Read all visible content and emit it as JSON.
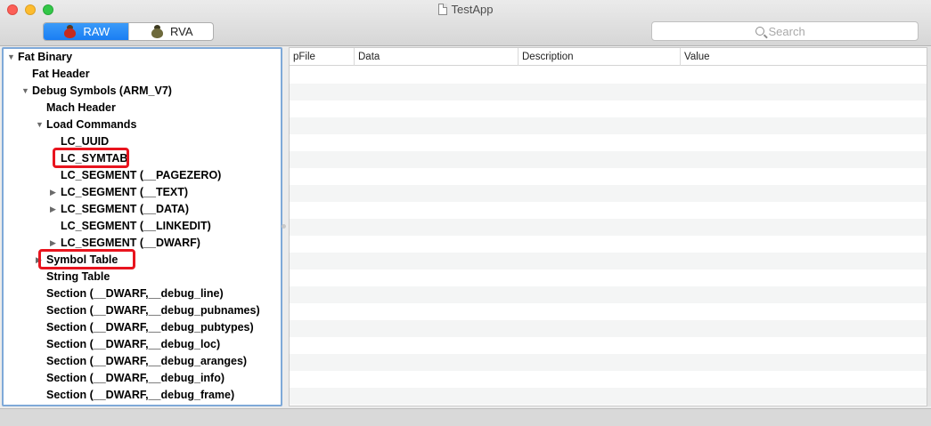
{
  "window": {
    "title": "TestApp"
  },
  "toolbar": {
    "segments": [
      {
        "label": "RAW",
        "active": true
      },
      {
        "label": "RVA",
        "active": false
      }
    ],
    "search": {
      "placeholder": "Search",
      "value": ""
    }
  },
  "outline": {
    "items": [
      {
        "label": "Fat Binary",
        "level": 0,
        "disclosure": "expanded"
      },
      {
        "label": "Fat Header",
        "level": 1,
        "disclosure": "none"
      },
      {
        "label": "Debug Symbols (ARM_V7)",
        "level": 1,
        "disclosure": "expanded"
      },
      {
        "label": "Mach Header",
        "level": 2,
        "disclosure": "none"
      },
      {
        "label": "Load Commands",
        "level": 2,
        "disclosure": "expanded"
      },
      {
        "label": "LC_UUID",
        "level": 3,
        "disclosure": "none"
      },
      {
        "label": "LC_SYMTAB",
        "level": 3,
        "disclosure": "none",
        "highlighted": true
      },
      {
        "label": "LC_SEGMENT (__PAGEZERO)",
        "level": 3,
        "disclosure": "none"
      },
      {
        "label": "LC_SEGMENT (__TEXT)",
        "level": 3,
        "disclosure": "collapsed"
      },
      {
        "label": "LC_SEGMENT (__DATA)",
        "level": 3,
        "disclosure": "collapsed"
      },
      {
        "label": "LC_SEGMENT (__LINKEDIT)",
        "level": 3,
        "disclosure": "none"
      },
      {
        "label": "LC_SEGMENT (__DWARF)",
        "level": 3,
        "disclosure": "collapsed"
      },
      {
        "label": "Symbol Table",
        "level": 2,
        "disclosure": "collapsed",
        "highlighted": true
      },
      {
        "label": "String Table",
        "level": 2,
        "disclosure": "none"
      },
      {
        "label": "Section (__DWARF,__debug_line)",
        "level": 2,
        "disclosure": "none"
      },
      {
        "label": "Section (__DWARF,__debug_pubnames)",
        "level": 2,
        "disclosure": "none"
      },
      {
        "label": "Section (__DWARF,__debug_pubtypes)",
        "level": 2,
        "disclosure": "none"
      },
      {
        "label": "Section (__DWARF,__debug_loc)",
        "level": 2,
        "disclosure": "none"
      },
      {
        "label": "Section (__DWARF,__debug_aranges)",
        "level": 2,
        "disclosure": "none"
      },
      {
        "label": "Section (__DWARF,__debug_info)",
        "level": 2,
        "disclosure": "none"
      },
      {
        "label": "Section (__DWARF,__debug_frame)",
        "level": 2,
        "disclosure": "none"
      }
    ]
  },
  "table": {
    "columns": [
      "pFile",
      "Data",
      "Description",
      "Value"
    ],
    "rows": []
  },
  "colors": {
    "highlight": "#e8141e",
    "selection_accent": "#1a7ef3",
    "outline_focus": "#7fa9d8"
  }
}
